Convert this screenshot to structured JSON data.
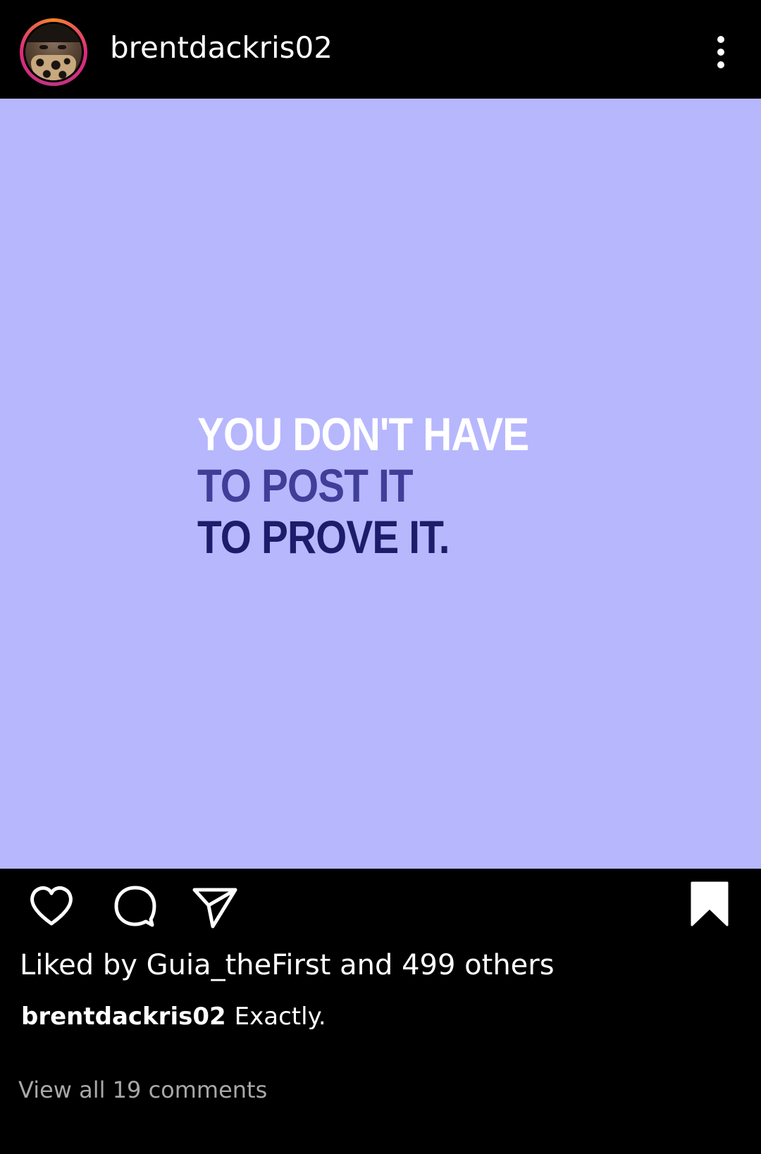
{
  "header": {
    "username": "brentdackris02",
    "more_icon": "more-vertical-icon"
  },
  "post": {
    "quote": {
      "line1": "YOU DON'T HAVE",
      "line2": "TO POST IT",
      "line3": "TO PROVE IT."
    },
    "colors": {
      "background": "#b7b7fe",
      "line1": "#ffffff",
      "line2": "#3f3f99",
      "line3": "#1c1c6b"
    }
  },
  "actions": {
    "like_icon": "heart-icon",
    "comment_icon": "comment-icon",
    "share_icon": "send-icon",
    "save_icon": "bookmark-icon"
  },
  "likes": {
    "text": "Liked by Guia_theFirst and 499 others"
  },
  "caption": {
    "username": "brentdackris02",
    "text": "Exactly."
  },
  "comments": {
    "link_text": "View all 19 comments"
  }
}
